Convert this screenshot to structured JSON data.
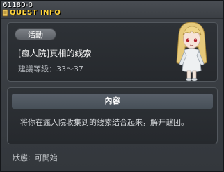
{
  "window": {
    "quest_id": "61180-0",
    "title": "QUEST INFO"
  },
  "summary": {
    "category": "活動",
    "quest_title": "[瘋人院]真相的线索",
    "recommended_level": "建議等級：33～37"
  },
  "content": {
    "header": "內容",
    "description": "将你在瘋人院收集到的线索结合起来，解开谜团。"
  },
  "status": {
    "label": "狀態:",
    "value": "可開始"
  },
  "colors": {
    "title_accent": "#ffd43a",
    "panel_bg": "#2a2d32",
    "window_bg": "#3a3e43"
  },
  "icons": {
    "title_icon": "scroll-icon",
    "npc": "npc-portrait-blonde-girl"
  }
}
